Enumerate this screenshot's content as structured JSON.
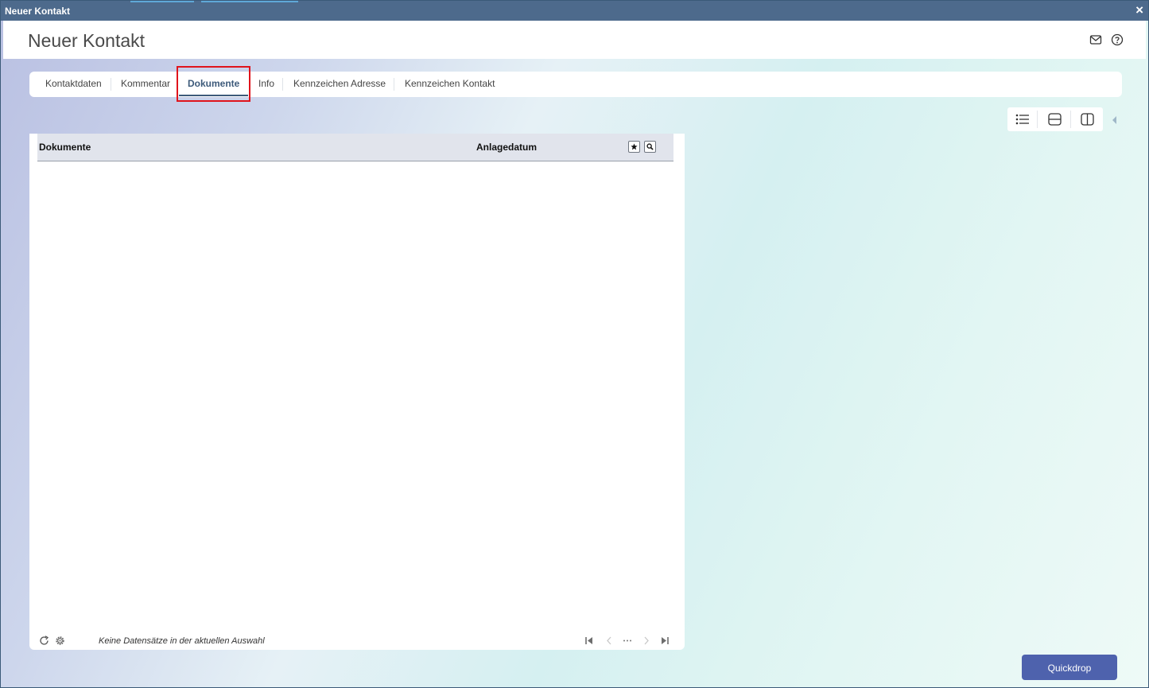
{
  "window": {
    "title": "Neuer Kontakt",
    "close_symbol": "×"
  },
  "header": {
    "title": "Neuer Kontakt",
    "icons": [
      "mail-icon",
      "help-icon"
    ]
  },
  "tabs": {
    "items": [
      {
        "label": "Kontaktdaten",
        "active": false
      },
      {
        "label": "Kommentar",
        "active": false
      },
      {
        "label": "Dokumente",
        "active": true
      },
      {
        "label": "Info",
        "active": false
      },
      {
        "label": "Kennzeichen Adresse",
        "active": false
      },
      {
        "label": "Kennzeichen Kontakt",
        "active": false
      }
    ]
  },
  "view_toolbar": {
    "buttons": [
      "list-view-icon",
      "horizontal-split-icon",
      "vertical-split-icon"
    ],
    "collapse": "collapse-left-icon"
  },
  "grid": {
    "columns": [
      "Dokumente",
      "Anlagedatum"
    ],
    "header_buttons": [
      "favorite-icon",
      "search-icon"
    ],
    "rows": [],
    "status": "Keine Datensätze in der aktuellen Auswahl",
    "footer_icons": [
      "refresh-icon",
      "settings-icon"
    ],
    "pager": [
      "first-page-icon",
      "previous-page-icon",
      "more-pages-icon",
      "next-page-icon",
      "last-page-icon"
    ]
  },
  "actions": {
    "quickdrop_label": "Quickdrop"
  },
  "colors": {
    "titlebar": "#4d6a8c",
    "active_tab": "#3d5a7a",
    "highlight": "#e0141c",
    "primary_button": "#4e62ad"
  }
}
